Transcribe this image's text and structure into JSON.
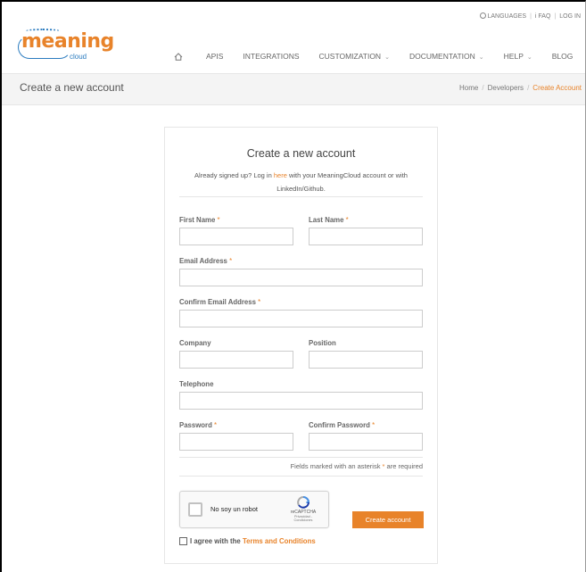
{
  "utility": {
    "languages": "LANGUAGES",
    "faq": "FAQ",
    "login": "LOG IN"
  },
  "logo": {
    "word": "meaning",
    "sub": "cloud"
  },
  "nav": {
    "items": [
      {
        "label": "APIS"
      },
      {
        "label": "INTEGRATIONS"
      },
      {
        "label": "CUSTOMIZATION"
      },
      {
        "label": "DOCUMENTATION"
      },
      {
        "label": "HELP"
      },
      {
        "label": "BLOG"
      }
    ]
  },
  "page": {
    "title": "Create a new account"
  },
  "breadcrumb": {
    "home": "Home",
    "developers": "Developers",
    "current": "Create Account"
  },
  "form": {
    "title": "Create a new account",
    "intro_pre": "Already signed up? Log in ",
    "intro_link": "here",
    "intro_post": " with your MeaningCloud account or with LinkedIn/Github.",
    "first_name_label": "First Name",
    "last_name_label": "Last Name",
    "email_label": "Email Address",
    "confirm_email_label": "Confirm Email Address",
    "company_label": "Company",
    "position_label": "Position",
    "telephone_label": "Telephone",
    "password_label": "Password",
    "confirm_password_label": "Confirm Password",
    "required_mark": "*",
    "note_pre": "Fields marked with an asterisk ",
    "note_post": " are required",
    "recaptcha_label": "No soy un robot",
    "recaptcha_brand": "reCAPTCHA",
    "recaptcha_links": "Privacidad - Condiciones",
    "submit_label": "Create account",
    "terms_pre": "I agree with the ",
    "terms_link": "Terms and Conditions"
  },
  "colors": {
    "accent": "#e8832a",
    "brand_blue": "#2a7bbf"
  }
}
